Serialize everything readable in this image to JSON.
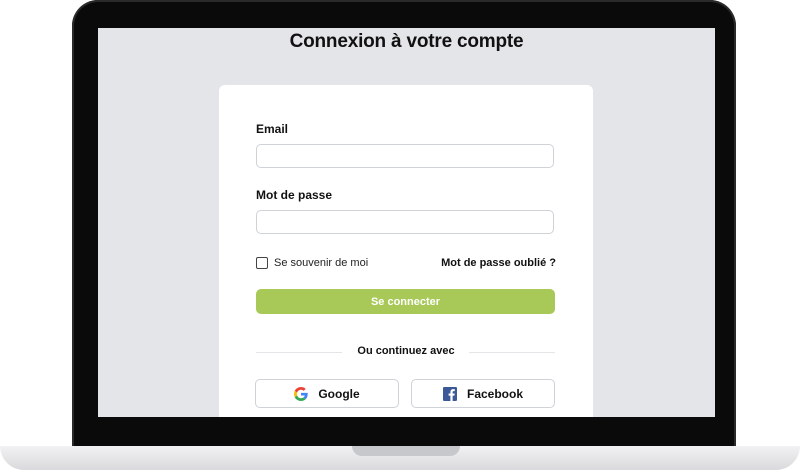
{
  "page": {
    "title": "Connexion à votre compte"
  },
  "form": {
    "email_label": "Email",
    "email_value": "",
    "password_label": "Mot de passe",
    "password_value": "",
    "remember_label": "Se souvenir de moi",
    "remember_checked": false,
    "forgot_link": "Mot de passe oublié ?",
    "submit_label": "Se connecter"
  },
  "social": {
    "divider_text": "Ou continuez avec",
    "google_label": "Google",
    "google_icon": "google-icon",
    "facebook_label": "Facebook",
    "facebook_icon": "facebook-icon"
  },
  "colors": {
    "accent": "#a8c957",
    "accent_text": "#ffffff",
    "screen_background": "#e4e5e9",
    "facebook_blue": "#3b5998"
  }
}
